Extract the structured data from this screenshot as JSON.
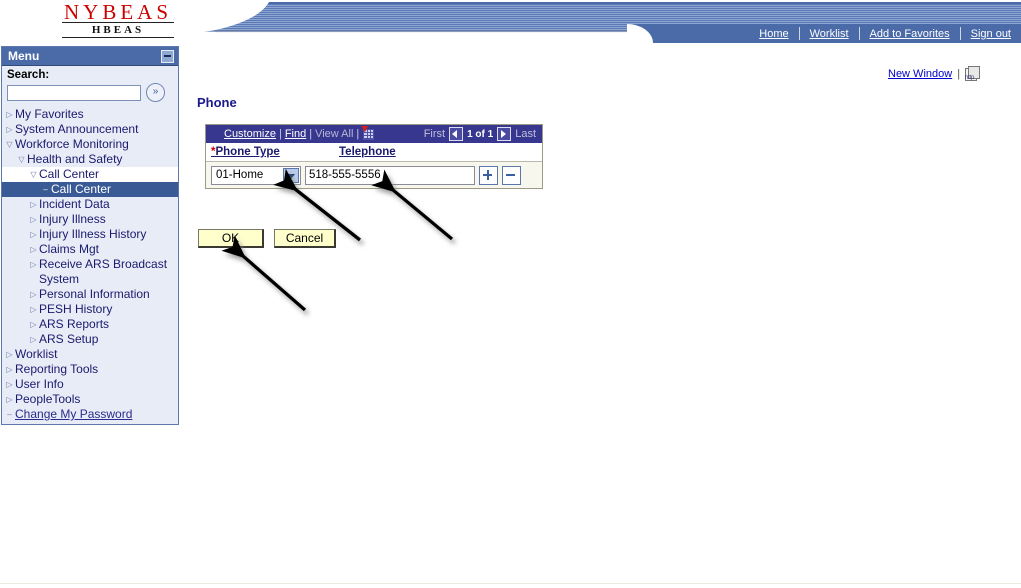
{
  "header": {
    "logo_main": "NYBEAS",
    "logo_sub": "HBEAS",
    "nav_links": [
      {
        "label": "Home",
        "name": "nav-home"
      },
      {
        "label": "Worklist",
        "name": "nav-worklist"
      },
      {
        "label": "Add to Favorites",
        "name": "nav-add-to-favorites"
      },
      {
        "label": "Sign out",
        "name": "nav-sign-out"
      }
    ]
  },
  "new_window": {
    "label": "New Window",
    "separator": "|",
    "icon_label": "http",
    "icon_name": "http-copy-icon"
  },
  "sidebar": {
    "title": "Menu",
    "minimize_icon": "minimize-icon",
    "search_label": "Search:",
    "search_value": "",
    "search_placeholder": "",
    "go_icon": "»",
    "items": [
      {
        "label": "My Favorites",
        "level": 1,
        "twisty": "collapsed",
        "selected": false,
        "link": false
      },
      {
        "label": "System Announcement",
        "level": 1,
        "twisty": "collapsed",
        "selected": false,
        "link": false
      },
      {
        "label": "Workforce Monitoring",
        "level": 1,
        "twisty": "expanded",
        "selected": false,
        "link": false
      },
      {
        "label": "Health and Safety",
        "level": 2,
        "twisty": "expanded",
        "selected": false,
        "link": false
      },
      {
        "label": "Call Center",
        "level": 3,
        "twisty": "expanded",
        "selected": false,
        "link": false,
        "white": true
      },
      {
        "label": "Call Center",
        "level": 4,
        "twisty": "dash",
        "selected": true,
        "link": false
      },
      {
        "label": "Incident Data",
        "level": 3,
        "twisty": "collapsed",
        "selected": false,
        "link": false
      },
      {
        "label": "Injury Illness",
        "level": 3,
        "twisty": "collapsed",
        "selected": false,
        "link": false
      },
      {
        "label": "Injury Illness History",
        "level": 3,
        "twisty": "collapsed",
        "selected": false,
        "link": false
      },
      {
        "label": "Claims Mgt",
        "level": 3,
        "twisty": "collapsed",
        "selected": false,
        "link": false
      },
      {
        "label": "Receive ARS Broadcast System",
        "level": 3,
        "twisty": "collapsed",
        "selected": false,
        "link": false
      },
      {
        "label": "Personal Information",
        "level": 3,
        "twisty": "collapsed",
        "selected": false,
        "link": false
      },
      {
        "label": "PESH History",
        "level": 3,
        "twisty": "collapsed",
        "selected": false,
        "link": false
      },
      {
        "label": "ARS Reports",
        "level": 3,
        "twisty": "collapsed",
        "selected": false,
        "link": false
      },
      {
        "label": "ARS Setup",
        "level": 3,
        "twisty": "collapsed",
        "selected": false,
        "link": false
      },
      {
        "label": "Worklist",
        "level": 1,
        "twisty": "collapsed",
        "selected": false,
        "link": false
      },
      {
        "label": "Reporting Tools",
        "level": 1,
        "twisty": "collapsed",
        "selected": false,
        "link": false
      },
      {
        "label": "User Info",
        "level": 1,
        "twisty": "collapsed",
        "selected": false,
        "link": false
      },
      {
        "label": "PeopleTools",
        "level": 1,
        "twisty": "collapsed",
        "selected": false,
        "link": false
      },
      {
        "label": "Change My Password",
        "level": 1,
        "twisty": "dash",
        "selected": false,
        "link": true
      }
    ]
  },
  "main": {
    "page_title": "Phone",
    "grid": {
      "toolbar": {
        "customize": "Customize",
        "find": "Find",
        "view_all": "View All",
        "pipe": "|",
        "download_icon": "spreadsheet-download-icon",
        "first": "First",
        "last": "Last",
        "counter": "1 of 1",
        "prev_icon": "previous-arrow-icon",
        "next_icon": "next-arrow-icon"
      },
      "columns": [
        {
          "label": "Phone Type",
          "required": true,
          "required_mark": "*"
        },
        {
          "label": "Telephone",
          "required": false,
          "required_mark": ""
        }
      ],
      "rows": [
        {
          "phone_type": "01-Home",
          "phone_type_options": [
            "01-Home"
          ],
          "telephone": "518-555-5556",
          "add_label": "+",
          "remove_label": "−"
        }
      ]
    },
    "buttons": {
      "ok": "OK",
      "cancel": "Cancel"
    }
  },
  "colors": {
    "nav_bar": "#4a6aa8",
    "grid_header": "#38378f",
    "selected_menu": "#3a5a96",
    "button_face": "#ffffcc",
    "logo_red": "#cc0000",
    "link_blue": "#0000cc"
  }
}
